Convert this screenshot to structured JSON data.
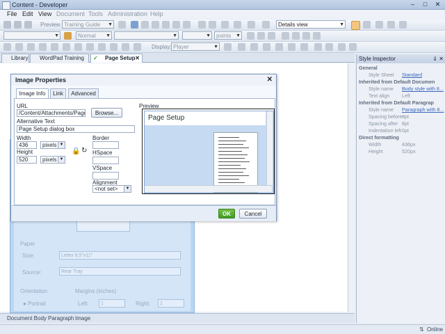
{
  "window": {
    "title": "Content - Developer"
  },
  "menubar": {
    "items": [
      {
        "label": "File",
        "enabled": true
      },
      {
        "label": "Edit",
        "enabled": true
      },
      {
        "label": "View",
        "enabled": true
      },
      {
        "label": "Document",
        "enabled": false
      },
      {
        "label": "Tools",
        "enabled": false
      },
      {
        "label": "Administration",
        "enabled": false
      },
      {
        "label": "Help",
        "enabled": false
      }
    ]
  },
  "toolbar1": {
    "preview_label": "Preview",
    "guide_combo": "Training Guide",
    "view_combo": "Details view"
  },
  "toolbar2": {
    "style_combo": "Normal",
    "size_unit_combo": "points"
  },
  "toolbar3": {
    "display_label": "Display:",
    "display_combo": "Player"
  },
  "tabs": [
    {
      "label": "Library"
    },
    {
      "label": "WordPad Training"
    },
    {
      "label": "Page Setup"
    }
  ],
  "dialog": {
    "title": "Image Properties",
    "tabs": [
      "Image Info",
      "Link",
      "Advanced"
    ],
    "url_label": "URL",
    "url_value": "/Content/Attachments/Page S",
    "browse_label": "Browse...",
    "alt_label": "Alternative Text",
    "alt_value": "Page Setup dialog box",
    "width_label": "Width",
    "width_value": "436",
    "width_unit": "pixels",
    "height_label": "Height",
    "height_value": "520",
    "height_unit": "pixels",
    "border_label": "Border",
    "hspace_label": "HSpace",
    "vspace_label": "VSpace",
    "alignment_label": "Alignment",
    "alignment_value": "<not set>",
    "preview_label": "Preview",
    "preview_title": "Page Setup",
    "ok_label": "OK",
    "cancel_label": "Cancel"
  },
  "background_dialog": {
    "paper_label": "Paper",
    "size_label": "Size:",
    "size_value": "Letter 8.5\"x11\"",
    "source_label": "Source:",
    "source_value": "Rear Tray",
    "orientation_label": "Orientation",
    "margins_label": "Margins (inches)",
    "portrait_label": "Portrait",
    "left_label": "Left:",
    "left_value": "1",
    "right_label": "Right:",
    "right_value": "1"
  },
  "statusbar": {
    "items": [
      "Document Body",
      "Paragraph",
      "Image"
    ]
  },
  "bottombar": {
    "status": "Online"
  },
  "inspector": {
    "title": "Style Inspector",
    "general": "General",
    "style_sheet_key": "Style Sheet",
    "style_sheet_val": "Standard",
    "inherited_doc": "Inherited from Default Documen",
    "style_name_key": "Style name",
    "style_name_val1": "Body style with 8...",
    "text_align_key": "Text align",
    "text_align_val": "Left",
    "inherited_para": "Inherited from Default Paragrap",
    "style_name_val2": "Paragraph with 8...",
    "spacing_before_key": "Spacing before",
    "spacing_before_val": "8pt",
    "spacing_after_key": "Spacing after",
    "spacing_after_val": "8pt",
    "indent_key": "Indentation left",
    "indent_val": "0pt",
    "direct": "Direct formatting",
    "width_key": "Width",
    "width_val": "436px",
    "height_key": "Height",
    "height_val": "520px"
  },
  "colors": {
    "accent": "#3f9b22",
    "title_bar": "#b3c6e0",
    "dialog_bg": "#f5f8fc"
  }
}
